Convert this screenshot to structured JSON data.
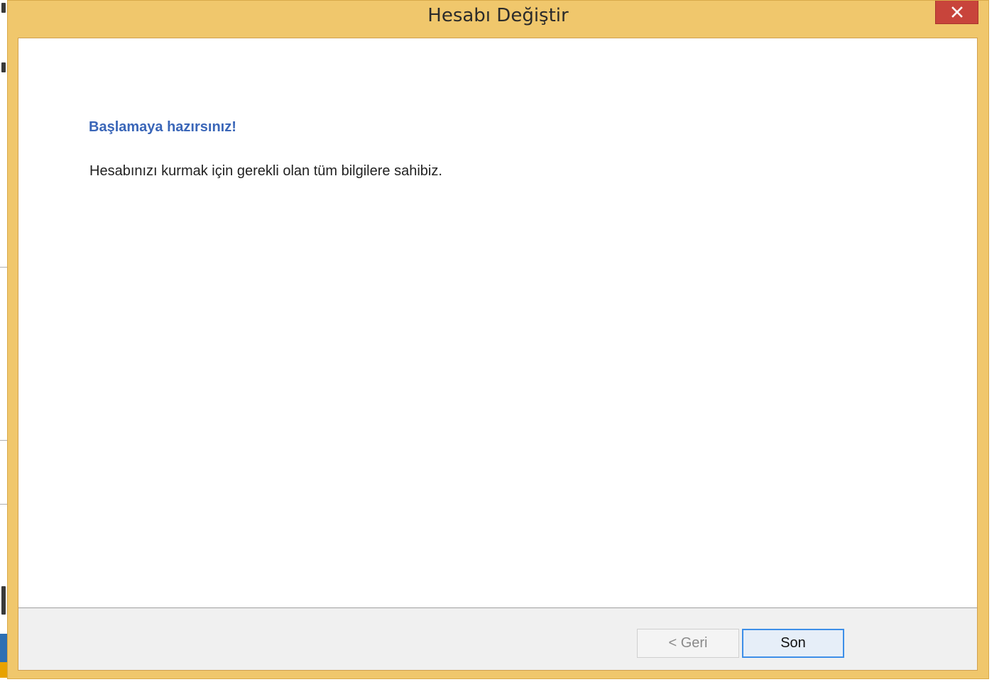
{
  "window": {
    "title": "Hesabı Değiştir",
    "close_icon": "close-icon"
  },
  "page": {
    "heading": "Başlamaya hazırsınız!",
    "description": "Hesabınızı kurmak için gerekli olan tüm bilgilere sahibiz."
  },
  "footer": {
    "back_label": "< Geri",
    "finish_label": "Son"
  },
  "colors": {
    "frame": "#f0c76c",
    "close_button": "#c8443b",
    "heading": "#3a66b8",
    "default_button_border": "#3d8ee8"
  }
}
